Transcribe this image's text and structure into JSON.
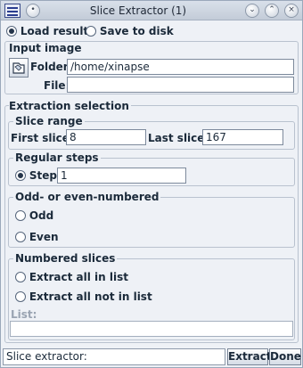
{
  "window": {
    "title": "Slice Extractor (1)"
  },
  "top_options": {
    "load_result": "Load result",
    "save_to_disk": "Save to disk"
  },
  "input_image": {
    "heading": "Input image",
    "folder_label": "Folder:",
    "folder_value": "/home/xinapse",
    "file_label": "File:",
    "file_value": ""
  },
  "extraction": {
    "heading": "Extraction selection",
    "slice_range": {
      "heading": "Slice range",
      "first_label": "First slice:",
      "first_value": "8",
      "last_label": "Last slice:",
      "last_value": "167"
    },
    "regular_steps": {
      "heading": "Regular steps",
      "step_label": "Step",
      "step_value": "1"
    },
    "odd_even": {
      "heading": "Odd- or even-numbered",
      "odd": "Odd",
      "even": "Even"
    },
    "numbered": {
      "heading": "Numbered slices",
      "all_in": "Extract all in list",
      "all_not_in": "Extract all not in list",
      "list_label": "List:",
      "list_value": ""
    }
  },
  "status": {
    "text": "Slice extractor:"
  },
  "buttons": {
    "extract": "Extract",
    "done": "Done"
  }
}
